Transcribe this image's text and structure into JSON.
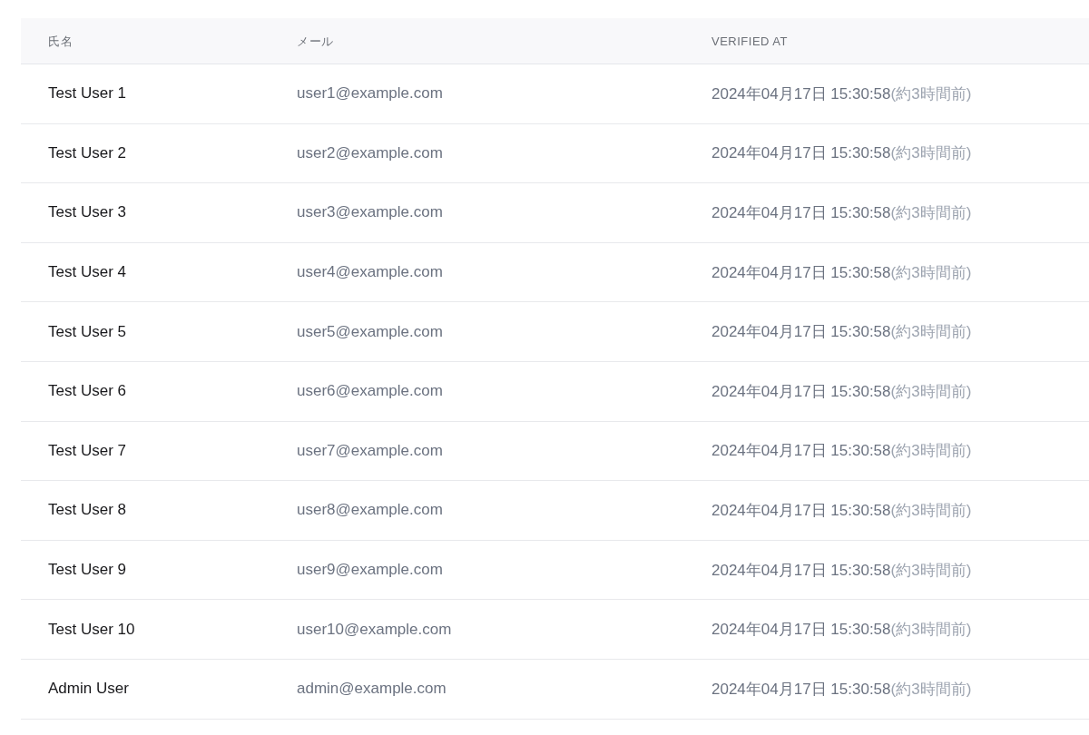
{
  "table": {
    "columns": [
      "氏名",
      "メール",
      "VERIFIED AT"
    ],
    "rows": [
      {
        "name": "Test User 1",
        "email": "user1@example.com",
        "verified_at": "2024年04月17日 15:30:58",
        "relative": "(約3時間前)"
      },
      {
        "name": "Test User 2",
        "email": "user2@example.com",
        "verified_at": "2024年04月17日 15:30:58",
        "relative": "(約3時間前)"
      },
      {
        "name": "Test User 3",
        "email": "user3@example.com",
        "verified_at": "2024年04月17日 15:30:58",
        "relative": "(約3時間前)"
      },
      {
        "name": "Test User 4",
        "email": "user4@example.com",
        "verified_at": "2024年04月17日 15:30:58",
        "relative": "(約3時間前)"
      },
      {
        "name": "Test User 5",
        "email": "user5@example.com",
        "verified_at": "2024年04月17日 15:30:58",
        "relative": "(約3時間前)"
      },
      {
        "name": "Test User 6",
        "email": "user6@example.com",
        "verified_at": "2024年04月17日 15:30:58",
        "relative": "(約3時間前)"
      },
      {
        "name": "Test User 7",
        "email": "user7@example.com",
        "verified_at": "2024年04月17日 15:30:58",
        "relative": "(約3時間前)"
      },
      {
        "name": "Test User 8",
        "email": "user8@example.com",
        "verified_at": "2024年04月17日 15:30:58",
        "relative": "(約3時間前)"
      },
      {
        "name": "Test User 9",
        "email": "user9@example.com",
        "verified_at": "2024年04月17日 15:30:58",
        "relative": "(約3時間前)"
      },
      {
        "name": "Test User 10",
        "email": "user10@example.com",
        "verified_at": "2024年04月17日 15:30:58",
        "relative": "(約3時間前)"
      },
      {
        "name": "Admin User",
        "email": "admin@example.com",
        "verified_at": "2024年04月17日 15:30:58",
        "relative": "(約3時間前)"
      }
    ]
  }
}
